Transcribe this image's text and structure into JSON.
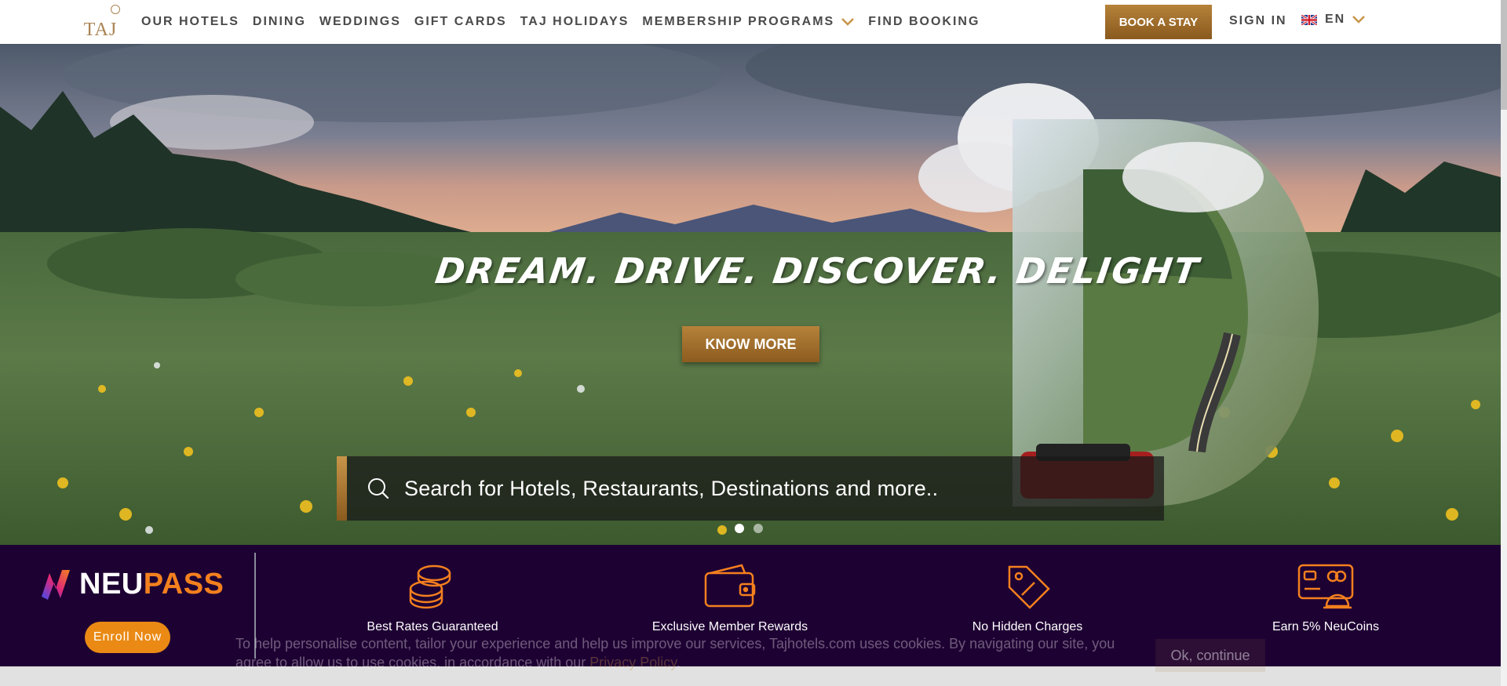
{
  "header": {
    "logo_text": "TAJ",
    "nav": [
      {
        "label": "OUR HOTELS"
      },
      {
        "label": "DINING"
      },
      {
        "label": "WEDDINGS"
      },
      {
        "label": "GIFT CARDS"
      },
      {
        "label": "TAJ HOLIDAYS"
      },
      {
        "label": "MEMBERSHIP PROGRAMS",
        "icon": "chevron-down-icon"
      },
      {
        "label": "FIND BOOKING"
      }
    ],
    "book_label": "BOOK A STAY",
    "signin_label": "SIGN IN",
    "language": {
      "label": "EN",
      "icon": "uk-flag-icon"
    }
  },
  "hero": {
    "headline": "DREAM. DRIVE. DISCOVER. DELIGHT",
    "cta_label": "KNOW MORE",
    "search": {
      "placeholder": "Search for Hotels, Restaurants, Destinations and more..",
      "icon": "search-icon"
    },
    "slides": {
      "count": 2,
      "active_index": 0
    }
  },
  "neupass": {
    "brand_white": "NEU",
    "brand_orange": "PASS",
    "enroll_label": "Enroll Now",
    "benefits": [
      {
        "label": "Best Rates Guaranteed",
        "icon": "coins-icon"
      },
      {
        "label": "Exclusive Member Rewards",
        "icon": "wallet-icon"
      },
      {
        "label": "No Hidden Charges",
        "icon": "price-tag-icon"
      },
      {
        "label": "Earn 5% NeuCoins",
        "icon": "card-dining-icon"
      }
    ]
  },
  "cookie": {
    "text": "To help personalise content, tailor your experience and help us improve our services, Tajhotels.com uses cookies. By navigating our site, you agree to allow us to use cookies, in accordance with our ",
    "link_label": "Privacy Policy",
    "suffix": ".",
    "button_label": "Ok, continue"
  },
  "colors": {
    "accent_gold": "#aa8453",
    "button_gold": "#a87330",
    "neupass_bg": "#1e0133",
    "neupass_orange": "#f3801e"
  }
}
